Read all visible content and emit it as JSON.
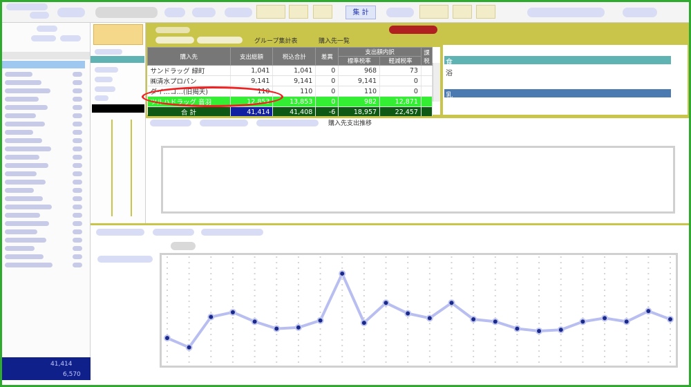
{
  "table": {
    "headers": {
      "vendor": "購入先",
      "total_spend": "支出総額",
      "tax_total": "税込合計",
      "difference": "差異",
      "breakdown_group": "支出額内訳",
      "standard_rate": "標準税率",
      "reduced_rate": "軽減税率",
      "extra": "課税"
    },
    "rows": [
      {
        "vendor": "サンドラッグ 緑町",
        "total_spend": "1,041",
        "tax_total": "1,041",
        "difference": "0",
        "standard_rate": "968",
        "reduced_rate": "73"
      },
      {
        "vendor": "㈱清水プロパン",
        "total_spend": "9,141",
        "tax_total": "9,141",
        "difference": "0",
        "standard_rate": "9,141",
        "reduced_rate": "0"
      },
      {
        "vendor": "ダイ…コ…(旧揭天)",
        "total_spend": "110",
        "tax_total": "110",
        "difference": "0",
        "standard_rate": "110",
        "reduced_rate": "0"
      },
      {
        "vendor": "ツルハドラッグ 音羽",
        "total_spend": "12,853",
        "tax_total": "13,853",
        "difference": "0",
        "standard_rate": "982",
        "reduced_rate": "12,871"
      }
    ],
    "totals": {
      "label": "合 計",
      "total_spend": "41,414",
      "tax_total": "41,408",
      "difference": "-6",
      "standard_rate": "18,957",
      "reduced_rate": "22,457"
    }
  },
  "toolbar": {
    "vendor_list_label": "購入先一覧",
    "group_label": "グループ集計表",
    "tab_active": "集 計"
  },
  "right_panel": {
    "food_label": "食",
    "bath_label": "浴",
    "milk_label": "乳"
  },
  "sidebar_totals": {
    "value_a": "41,414",
    "value_b": "6,570"
  },
  "chart_toolbar_top": {
    "vendor_trend_label": "購入先支出推移"
  },
  "colors": {
    "accent_olive": "#c9c44a",
    "selected_row": "#33ee33",
    "total_row": "#0e5a14",
    "highlight_blue": "#1020a0",
    "callout_red": "#ee2222",
    "line_series": "#b8bff0",
    "marker": "#1a2a8a"
  },
  "chart_data": {
    "type": "line",
    "title": "",
    "xlabel": "",
    "ylabel": "",
    "series": [
      {
        "values": [
          30,
          22,
          48,
          52,
          44,
          38,
          39,
          45,
          85,
          43,
          60,
          51,
          47,
          60,
          46,
          44,
          38,
          36,
          37,
          44,
          47,
          44,
          53,
          46
        ]
      }
    ],
    "grid": true,
    "legend": "none"
  }
}
